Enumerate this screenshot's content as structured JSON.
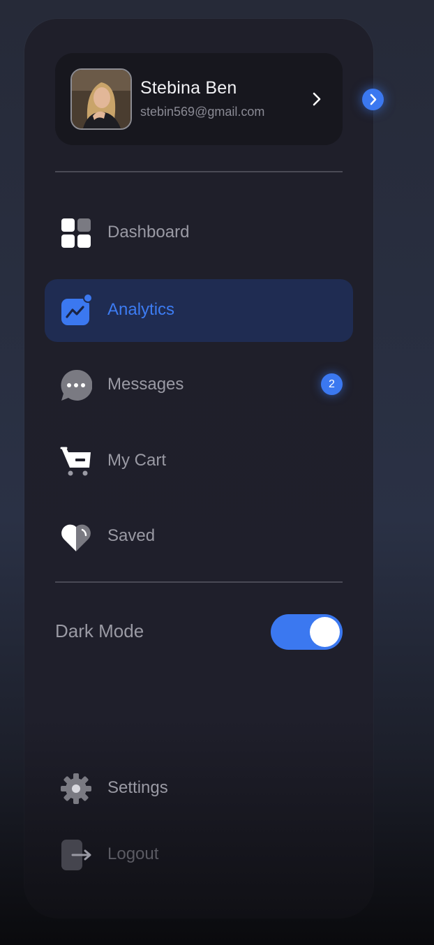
{
  "profile": {
    "name": "Stebina Ben",
    "email": "stebin569@gmail.com",
    "avatar_icon": "user-avatar-photo",
    "chevron_icon": "chevron-right-icon"
  },
  "collapse_button": {
    "icon": "chevron-right-icon",
    "color": "#3b78f0"
  },
  "nav": {
    "items": [
      {
        "label": "Dashboard",
        "icon": "dashboard-grid-icon",
        "active": false
      },
      {
        "label": "Analytics",
        "icon": "analytics-chart-icon",
        "active": true
      },
      {
        "label": "Messages",
        "icon": "chat-bubble-icon",
        "active": false,
        "badge": "2"
      },
      {
        "label": "My Cart",
        "icon": "shopping-cart-icon",
        "active": false
      },
      {
        "label": "Saved",
        "icon": "heart-icon",
        "active": false
      }
    ]
  },
  "dark_mode": {
    "label": "Dark Mode",
    "enabled": true
  },
  "footer": {
    "settings_label": "Settings",
    "settings_icon": "gear-icon",
    "logout_label": "Logout",
    "logout_icon": "logout-icon"
  },
  "colors": {
    "accent": "#3b78f0",
    "active_bg": "#1f2c52",
    "panel_bg": "#1f1f2a"
  }
}
